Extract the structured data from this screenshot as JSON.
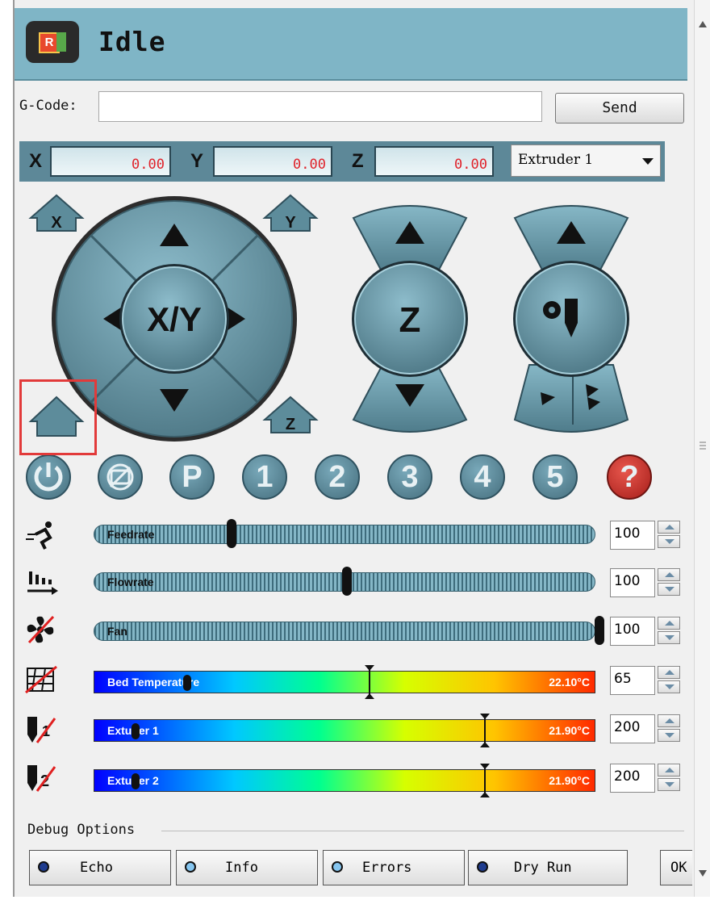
{
  "header": {
    "status": "Idle",
    "logo_letter": "R"
  },
  "gcode": {
    "label": "G-Code:",
    "value": "",
    "send_label": "Send"
  },
  "coordinates": [
    {
      "axis": "X",
      "value": "0.00"
    },
    {
      "axis": "Y",
      "value": "0.00"
    },
    {
      "axis": "Z",
      "value": "0.00"
    }
  ],
  "extruder_select": {
    "selected": "Extruder 1"
  },
  "jog": {
    "xy_label": "X/Y",
    "z_label": "Z",
    "home_x_label": "X",
    "home_y_label": "Y",
    "home_z_label": "Z"
  },
  "functions": [
    "1",
    "2",
    "3",
    "4",
    "5"
  ],
  "function_p_label": "P",
  "help_label": "?",
  "sliders": [
    {
      "label": "Feedrate",
      "value": "100",
      "position_pct": 27
    },
    {
      "label": "Flowrate",
      "value": "100",
      "position_pct": 50
    },
    {
      "label": "Fan",
      "value": "100",
      "position_pct": 100
    }
  ],
  "temperatures": [
    {
      "label": "Bed Temperature",
      "current": "22.10°C",
      "target": "65"
    },
    {
      "label": "Extuder 1",
      "current": "21.90°C",
      "target": "200"
    },
    {
      "label": "Extuder 2",
      "current": "21.90°C",
      "target": "200"
    }
  ],
  "debug": {
    "title": "Debug Options",
    "buttons": [
      {
        "label": "Echo",
        "led": "#1f3c8f"
      },
      {
        "label": "Info",
        "led": "#86c6f0"
      },
      {
        "label": "Errors",
        "led": "#86c6f0"
      },
      {
        "label": "Dry Run",
        "led": "#1f3c8f"
      }
    ],
    "ok_label": "OK"
  },
  "colors": {
    "accent": "#7fb5c6",
    "control": "#5a8796",
    "value_text": "#e0222a"
  }
}
